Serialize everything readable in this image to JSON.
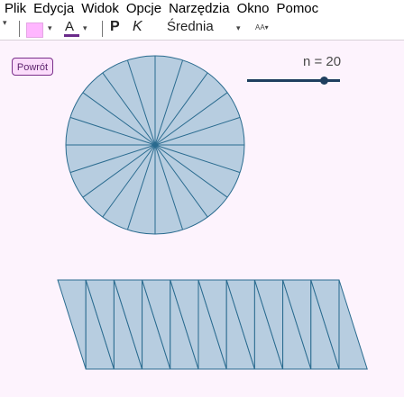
{
  "menu": [
    "Plik",
    "Edycja",
    "Widok",
    "Opcje",
    "Narzędzia",
    "Okno",
    "Pomoc"
  ],
  "toolbar": {
    "menu_arrow": "▾",
    "color_arrow": "▾",
    "text_color_glyph": "A",
    "text_color_arrow": "▾",
    "bold": "P",
    "italic": "K",
    "font_size": "Średnia",
    "font_size_arrow": "▾",
    "font_size_toggle": "AA▾"
  },
  "back_button": "Powrót",
  "slider": {
    "label": "n = 20",
    "value": 20,
    "min": 1,
    "max": 24
  },
  "colors": {
    "fill": "#b7cde0",
    "stroke": "#2a6b8f",
    "accent": "#7a2f8a"
  }
}
